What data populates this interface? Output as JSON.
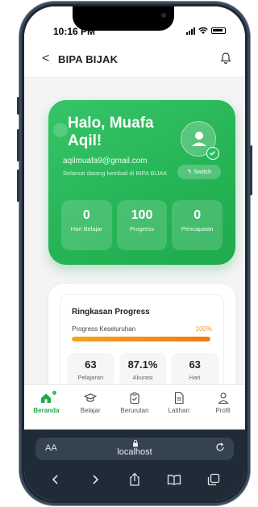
{
  "status_bar": {
    "time": "10:16 PM"
  },
  "app_bar": {
    "back_glyph": "<",
    "title": "BIPA BIJAK",
    "notification_icon": "bell-icon"
  },
  "hero": {
    "greeting": "Halo, Muafa Aqil!",
    "email": "aqilmuafa9@gmail.com",
    "welcome": "Selamat datang kembali di BIPA BIJAK",
    "switch_label": "Switch",
    "switch_icon": "↰",
    "stats": [
      {
        "value": "0",
        "label": "Hari Belajar"
      },
      {
        "value": "100",
        "label": "Progress"
      },
      {
        "value": "0",
        "label": "Pencapaian"
      }
    ],
    "colors": {
      "green": "#26b556",
      "badge": "#2dbd5e"
    }
  },
  "progress_card": {
    "title": "Ringkasan Progress",
    "overall_label": "Progress Keseluruhan",
    "overall_pct": "100%",
    "overall_value": 1.0,
    "bar_color": "#f39c12",
    "stats": [
      {
        "value": "63",
        "label": "Pelajaran"
      },
      {
        "value": "87.1%",
        "label": "Akurasi"
      },
      {
        "value": "63",
        "label": "Hari"
      }
    ]
  },
  "bottom_nav": {
    "items": [
      {
        "label": "Beranda",
        "icon": "home-icon",
        "active": true
      },
      {
        "label": "Belajar",
        "icon": "graduation-cap-icon",
        "active": false
      },
      {
        "label": "Berurutan",
        "icon": "clipboard-check-icon",
        "active": false
      },
      {
        "label": "Latihan",
        "icon": "document-icon",
        "active": false
      },
      {
        "label": "Profil",
        "icon": "user-icon",
        "active": false
      }
    ],
    "active_color": "#22a84b"
  },
  "browser": {
    "aa_label": "AA",
    "url": "localhost",
    "toolbar_icons": [
      "back-icon",
      "forward-icon",
      "share-icon",
      "bookmarks-icon",
      "tabs-icon"
    ]
  }
}
